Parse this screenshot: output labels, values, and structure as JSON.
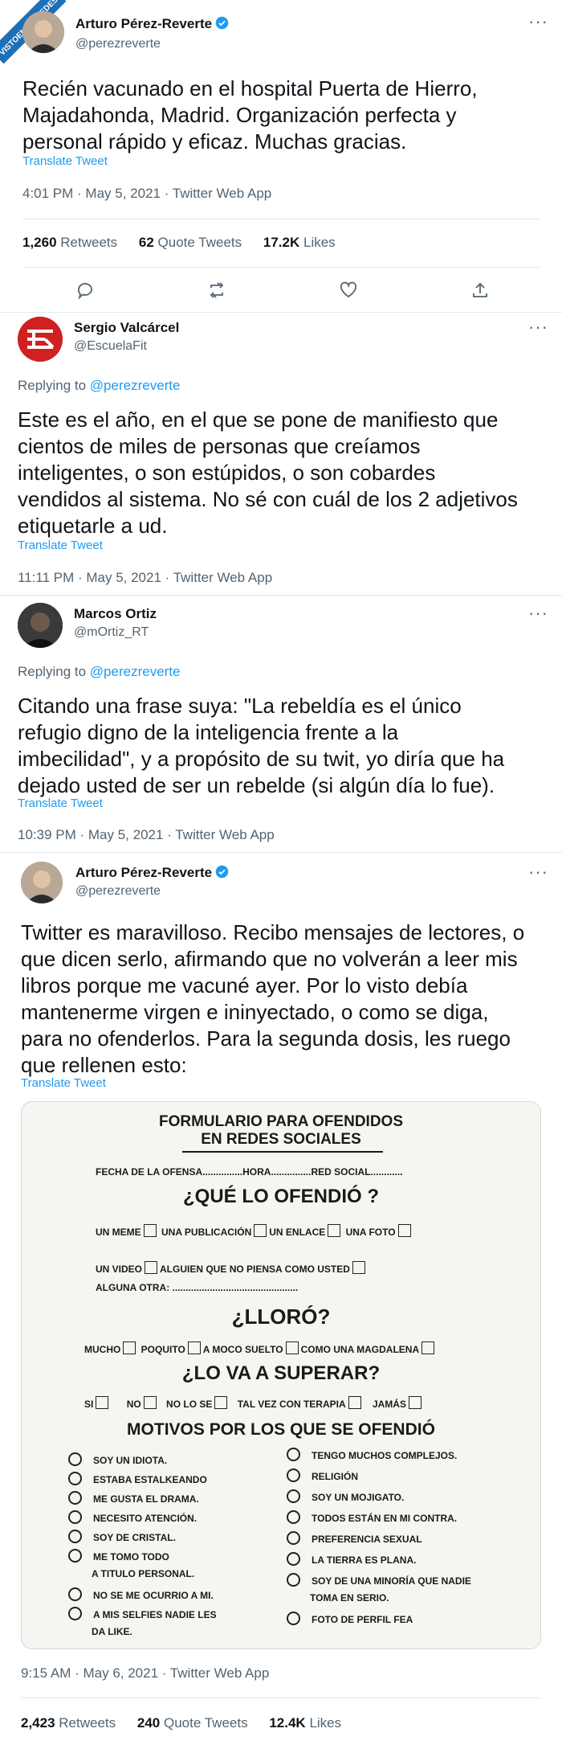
{
  "watermark": "VISTOENLASREDES",
  "tweet1": {
    "name": "Arturo Pérez-Reverte",
    "handle": "@perezreverte",
    "text": "Recién vacunado en el hospital Puerta de Hierro,\nMajadahonda, Madrid. Organización perfecta y\npersonal rápido y eficaz. Muchas gracias.",
    "translate": "Translate Tweet",
    "meta": "4:01 PM · May 5, 2021 · Twitter Web App",
    "retweets": "1,260",
    "retweets_label": "Retweets",
    "quotes": "62",
    "quotes_label": "Quote Tweets",
    "likes": "17.2K",
    "likes_label": "Likes"
  },
  "reply1": {
    "name": "Sergio Valcárcel",
    "handle": "@EscuelaFit",
    "replying_label": "Replying to",
    "replying_to": "@perezreverte",
    "text": "Este es el año, en el que se pone de manifiesto que\ncientos de miles de personas que creíamos\ninteligentes, o son estúpidos, o son cobardes\nvendidos al sistema. No sé con cuál de los 2 adjetivos\netiquetarle a ud.",
    "translate": "Translate Tweet",
    "meta": "11:11 PM · May 5, 2021 · Twitter Web App"
  },
  "reply2": {
    "name": "Marcos Ortiz",
    "handle": "@mOrtiz_RT",
    "replying_label": "Replying to",
    "replying_to": "@perezreverte",
    "text": "Citando una frase suya: \"La rebeldía es el único\nrefugio digno de la inteligencia frente a la\nimbecilidad\", y a propósito de su twit, yo diría que ha\ndejado usted de ser un rebelde (si algún día lo fue).",
    "translate": "Translate Tweet",
    "meta": "10:39 PM · May 5, 2021 · Twitter Web App"
  },
  "tweet2": {
    "name": "Arturo Pérez-Reverte",
    "handle": "@perezreverte",
    "text": "Twitter es maravilloso. Recibo mensajes de lectores, o\nque dicen serlo, afirmando que no volverán a leer mis\nlibros porque me vacuné ayer. Por lo visto debía\nmantenerme virgen e ininyectado, o como se diga,\npara no ofenderlos. Para la segunda dosis, les ruego\nque rellenen esto:",
    "translate": "Translate Tweet",
    "meta": "9:15 AM · May 6, 2021 · Twitter Web App",
    "retweets": "2,423",
    "retweets_label": "Retweets",
    "quotes": "240",
    "quotes_label": "Quote Tweets",
    "likes": "12.4K",
    "likes_label": "Likes"
  },
  "form": {
    "title1": "FORMULARIO PARA OFENDIDOS",
    "title2": "EN REDES SOCIALES",
    "line1_a": "FECHA DE LA OFENSA...............",
    "line1_b": "HORA...............",
    "line1_c": "RED SOCIAL............",
    "q1": "¿QUÉ LO OFENDIÓ ?",
    "opt_meme": "UN MEME",
    "opt_pub": "UNA PUBLICACIÓN",
    "opt_enlace": "UN ENLACE",
    "opt_foto": "UNA FOTO",
    "opt_video": "UN VIDEO",
    "opt_alguien": "ALGUIEN QUE NO PIENSA COMO USTED",
    "opt_otra": "ALGUNA OTRA: ...............................................",
    "q2": "¿LLORÓ?",
    "opt_mucho": "MUCHO",
    "opt_poquito": "POQUITO",
    "opt_moco": "A MOCO SUELTO",
    "opt_magdalena": "COMO UNA MAGDALENA",
    "q3": "¿LO VA A  SUPERAR?",
    "opt_si": "SI",
    "opt_no": "NO",
    "opt_nolose": "NO LO SE",
    "opt_terapia": "TAL VEZ CON TERAPIA",
    "opt_jamas": "JAMÁS",
    "q4": "MOTIVOS POR LOS QUE SE OFENDIÓ",
    "left_items": [
      "SOY UN IDIOTA.",
      "ESTABA ESTALKEANDO",
      "ME GUSTA EL DRAMA.",
      "NECESITO ATENCIÓN.",
      "SOY DE CRISTAL.",
      "ME TOMO TODO",
      "NO SE ME OCURRIO A MI.",
      "A MIS SELFIES NADIE LES"
    ],
    "left_cont1": "A TITULO PERSONAL.",
    "left_cont2": "DA LIKE.",
    "right_items": [
      "TENGO MUCHOS  COMPLEJOS.",
      "RELIGIÓN",
      "SOY UN MOJIGATO.",
      "TODOS ESTÁN EN MI CONTRA.",
      "PREFERENCIA SEXUAL",
      "LA TIERRA ES PLANA.",
      "SOY DE UNA MINORÍA QUE NADIE",
      "FOTO DE PERFIL FEA"
    ],
    "right_cont1": "TOMA EN SERIO."
  },
  "colors": {
    "link": "#1d9bf0",
    "verified": "#1d9bf0",
    "escuelafit_red": "#d0201f",
    "watermark_blue": "#1d6fb8"
  }
}
